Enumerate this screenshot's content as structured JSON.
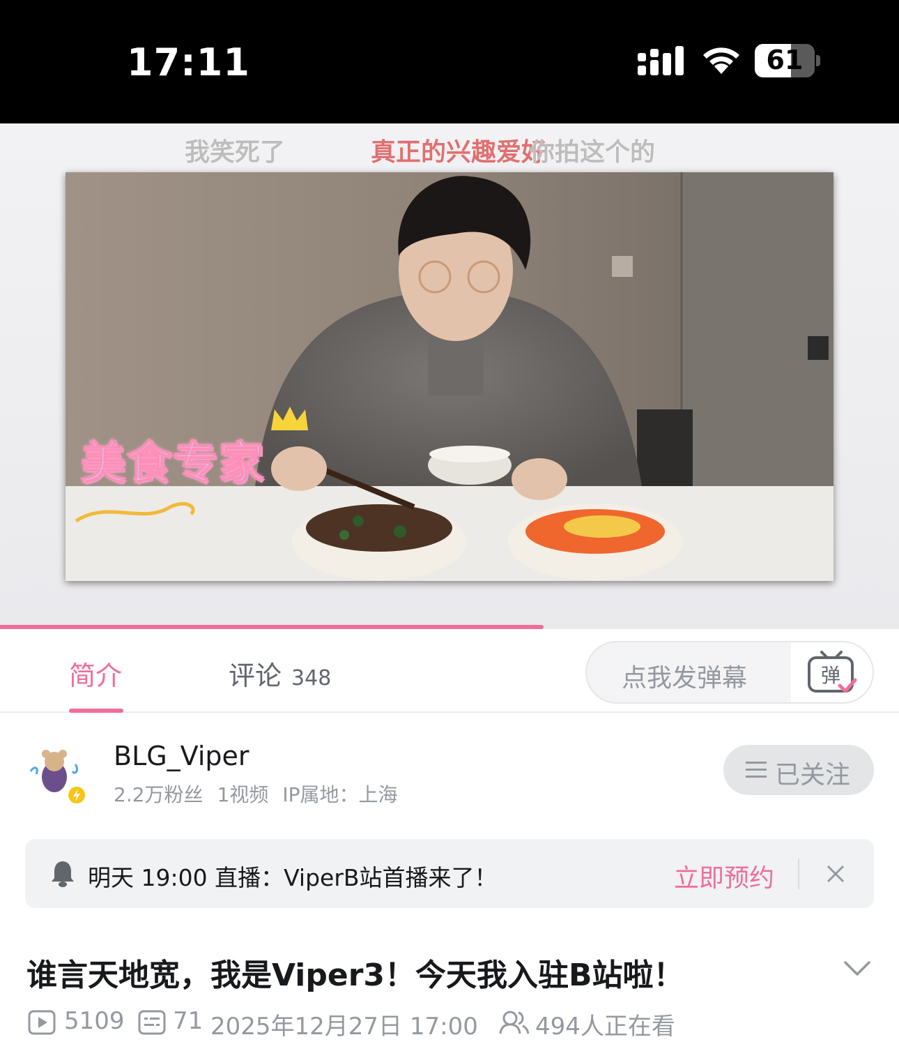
{
  "status_bar": {
    "time": "17:11",
    "battery": "61",
    "battery_level": 0.61
  },
  "danmaku": [
    {
      "text": "我笑死了",
      "color": "#bdbdbd"
    },
    {
      "text": "真正的兴趣爱好",
      "color": "#e07070"
    },
    {
      "text": "你拍这个的",
      "color": "#bdbdbd"
    }
  ],
  "video": {
    "overlay_badge": "美食专家",
    "progress": 0.605
  },
  "tabs": {
    "intro_label": "简介",
    "comments_label": "评论",
    "comments_count": "348",
    "danmaku_placeholder": "点我发弹幕",
    "danmaku_button_glyph": "弹"
  },
  "uploader": {
    "name": "BLG_Viper",
    "fans": "2.2万粉丝",
    "videos": "1视频",
    "ip": "IP属地：上海",
    "follow_label": "已关注"
  },
  "reservation": {
    "text": "明天 19:00 直播：ViperB站首播来了！",
    "cta": "立即预约"
  },
  "video_info": {
    "title": "谁言天地宽，我是Viper3！今天我入驻B站啦！",
    "plays": "5109",
    "danmaku_count": "71",
    "date": "2025年12月27日 17:00",
    "watching": "494人正在看"
  },
  "colors": {
    "accent": "#ee6f98",
    "text": "#18191c",
    "muted": "#9499a0"
  }
}
